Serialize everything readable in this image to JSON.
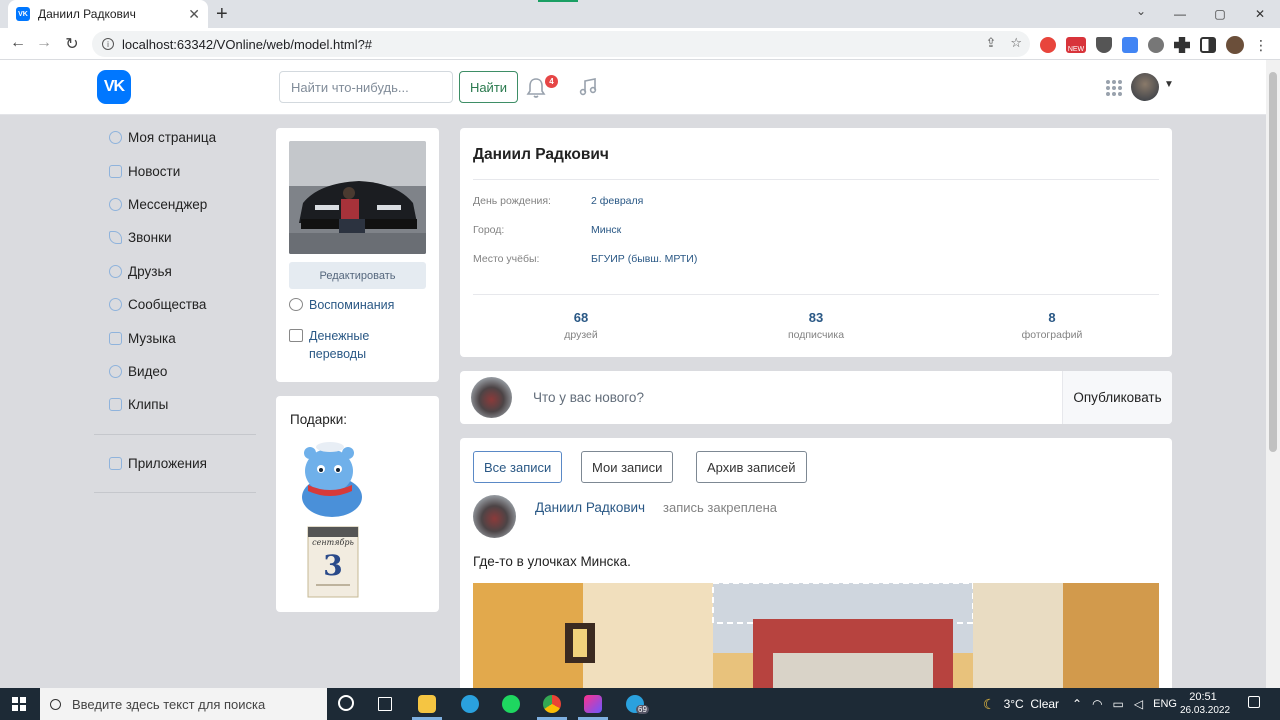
{
  "browser": {
    "tab_title": "Даниил Радкович",
    "url": "localhost:63342/VOnline/web/model.html?#",
    "ext_badge": "NEW"
  },
  "vk": {
    "logo_text": "VK",
    "search_placeholder": "Найти что-нибудь...",
    "search_button": "Найти",
    "notification_count": "4",
    "accent_color": "#0077ff"
  },
  "sidebar": {
    "items": [
      {
        "label": "Моя страница",
        "icon": "user-icon"
      },
      {
        "label": "Новости",
        "icon": "news-icon"
      },
      {
        "label": "Мессенджер",
        "icon": "message-icon"
      },
      {
        "label": "Звонки",
        "icon": "phone-icon"
      },
      {
        "label": "Друзья",
        "icon": "friends-icon"
      },
      {
        "label": "Сообщества",
        "icon": "communities-icon"
      },
      {
        "label": "Музыка",
        "icon": "music-icon"
      },
      {
        "label": "Видео",
        "icon": "video-icon"
      },
      {
        "label": "Клипы",
        "icon": "clips-icon"
      }
    ],
    "apps_label": "Приложения"
  },
  "profile_side": {
    "edit_button": "Редактировать",
    "memories_link": "Воспоминания",
    "transfers_link": "Денежные переводы",
    "gifts_title": "Подарки:",
    "calendar_month": "сентябрь",
    "calendar_day": "3"
  },
  "profile": {
    "name": "Даниил Радкович",
    "info": [
      {
        "label": "День рождения:",
        "value": "2 февраля"
      },
      {
        "label": "Город:",
        "value": "Минск"
      },
      {
        "label": "Место учёбы:",
        "value": "БГУИР (бывш. МРТИ)"
      }
    ],
    "counters": [
      {
        "value": "68",
        "label": "друзей"
      },
      {
        "value": "83",
        "label": "подписчика"
      },
      {
        "value": "8",
        "label": "фотографий"
      }
    ]
  },
  "composer": {
    "placeholder": "Что у вас нового?",
    "publish_button": "Опубликовать"
  },
  "posts": {
    "filters": [
      "Все записи",
      "Мои записи",
      "Архив записей"
    ],
    "active_filter": "Все записи",
    "post": {
      "author": "Даниил Радкович",
      "status": "запись закреплена",
      "text": "Где-то в улочках Минска."
    }
  },
  "taskbar": {
    "search_placeholder": "Введите здесь текст для поиска",
    "weather": "3°C  Clear",
    "language": "ENG",
    "time": "20:51",
    "date": "26.03.2022",
    "telegram_badge": "69"
  }
}
